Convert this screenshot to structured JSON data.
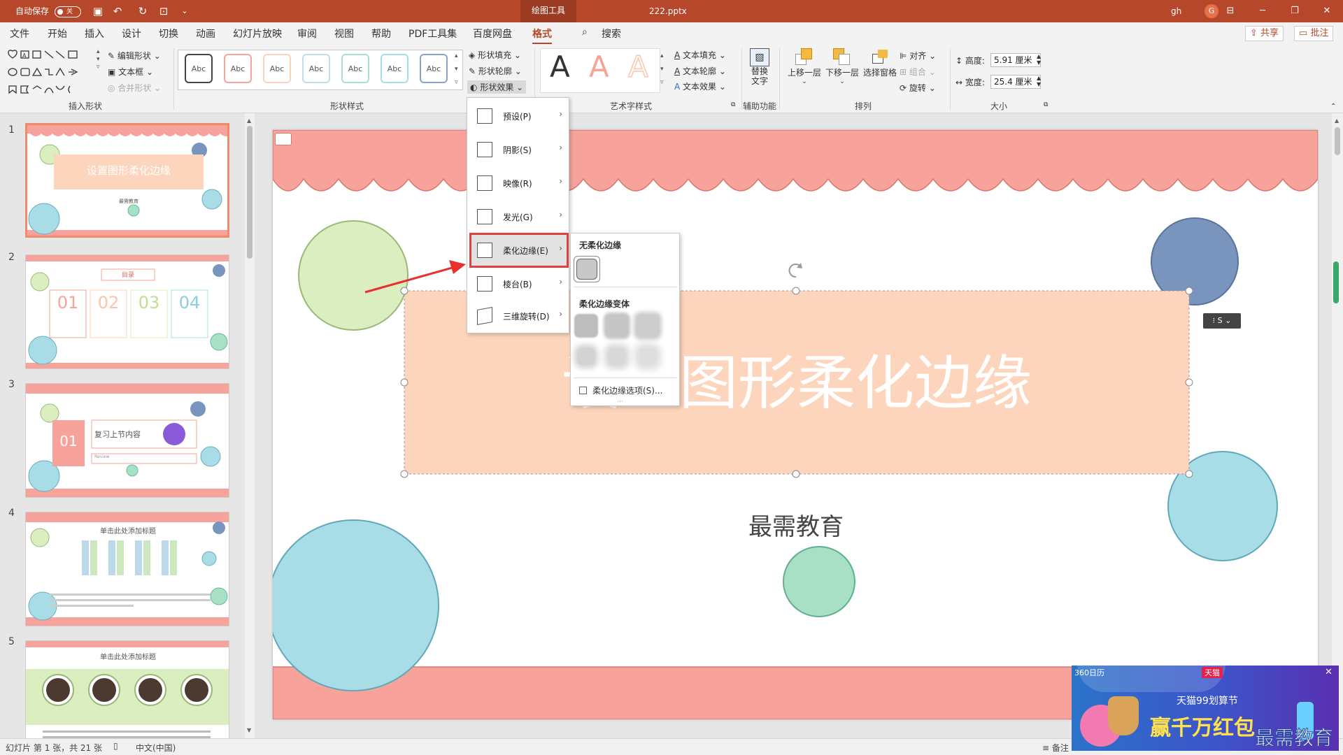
{
  "titlebar": {
    "autosave_label": "自动保存",
    "autosave_state": "关",
    "context_tab": "绘图工具",
    "filename": "222.pptx",
    "user": "gh",
    "avatar_letter": "G",
    "minimize": "─",
    "restore": "❐",
    "close": "✕"
  },
  "tabs": [
    "文件",
    "开始",
    "插入",
    "设计",
    "切换",
    "动画",
    "幻灯片放映",
    "审阅",
    "视图",
    "帮助",
    "PDF工具集",
    "百度网盘",
    "格式"
  ],
  "search": "搜索",
  "share_label": "共享",
  "comment_label": "批注",
  "ribbon": {
    "insert_shape": {
      "edit_shape": "编辑形状",
      "textbox": "文本框",
      "merge": "合并形状",
      "group_label": "插入形状"
    },
    "shape_styles": {
      "samples": [
        "Abc",
        "Abc",
        "Abc",
        "Abc",
        "Abc",
        "Abc",
        "Abc"
      ],
      "fill": "形状填充",
      "outline": "形状轮廓",
      "effects": "形状效果",
      "group_label": "形状样式"
    },
    "wordart": {
      "letters": [
        "A",
        "A",
        "A"
      ],
      "text_fill": "文本填充",
      "text_outline": "文本轮廓",
      "text_effects": "文本效果",
      "group_label": "艺术字样式"
    },
    "accessibility": {
      "alt_text": "替换\n文字",
      "group_label": "辅助功能"
    },
    "arrange": {
      "bring_forward": "上移一层",
      "send_backward": "下移一层",
      "selection_pane": "选择窗格",
      "align": "对齐",
      "group": "组合",
      "rotate": "旋转",
      "group_label": "排列"
    },
    "size": {
      "height_label": "高度:",
      "height_value": "5.91 厘米",
      "width_label": "宽度:",
      "width_value": "25.4 厘米",
      "group_label": "大小"
    }
  },
  "menu": [
    {
      "label": "预设(P)"
    },
    {
      "label": "阴影(S)"
    },
    {
      "label": "映像(R)"
    },
    {
      "label": "发光(G)"
    },
    {
      "label": "柔化边缘(E)"
    },
    {
      "label": "棱台(B)"
    },
    {
      "label": "三维旋转(D)"
    }
  ],
  "submenu": {
    "none_label": "无柔化边缘",
    "variants_label": "柔化边缘变体",
    "options_label": "柔化边缘选项(S)..."
  },
  "slides": [
    {
      "num": "1",
      "title": "设置图形柔化边缘",
      "sub": "最需教育"
    },
    {
      "num": "2",
      "title": "目录",
      "items": [
        "01",
        "02",
        "03",
        "04"
      ]
    },
    {
      "num": "3",
      "badge": "01",
      "text": "复习上节内容",
      "tag": "Review"
    },
    {
      "num": "4",
      "title": "单击此处添加标题"
    },
    {
      "num": "5",
      "title": "单击此处添加标题"
    }
  ],
  "main_slide": {
    "title": "设置图形柔化边缘",
    "subtitle": "最需教育"
  },
  "status": {
    "slide_info": "幻灯片 第 1 张，共 21 张",
    "language": "中文(中国)",
    "notes": "备注"
  },
  "ad": {
    "tag": "360日历",
    "brand": "天猫",
    "event": "天猫99划算节",
    "headline": "赢千万红包",
    "watermark": "最需教育"
  },
  "colors": {
    "accent": "#b7472a",
    "salmon": "#f7a39b",
    "peach": "#fdd5bc",
    "blue": "#a8dce6",
    "navy": "#7a95bd",
    "green": "#a8e0c6",
    "lime": "#dbeec0"
  }
}
